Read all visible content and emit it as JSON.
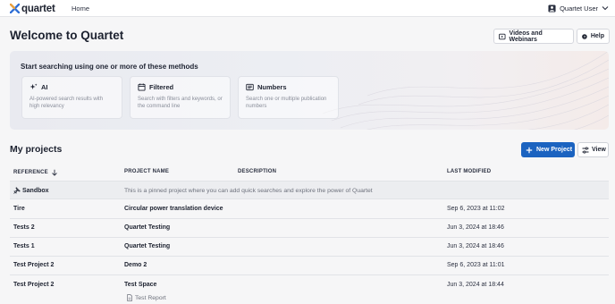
{
  "app": {
    "brand": "quartet",
    "nav_home": "Home",
    "user_name": "Quartet User",
    "colors": {
      "accent": "#1b63c0",
      "logo_mark": "#2f6fd6",
      "text": "#1d2230",
      "muted": "#6d717c"
    }
  },
  "header": {
    "title": "Welcome to Quartet",
    "videos_label": "Videos and Webinars",
    "help_label": "Help"
  },
  "search": {
    "title": "Start searching using one or more of these methods",
    "methods": [
      {
        "label": "AI",
        "icon": "sparkle-icon",
        "description": "AI-powered search results with high relevancy"
      },
      {
        "label": "Filtered",
        "icon": "calendar-icon",
        "description": "Search with filters and keywords, or the command line"
      },
      {
        "label": "Numbers",
        "icon": "numbers-icon",
        "description": "Search one or multiple publication numbers"
      }
    ]
  },
  "projects": {
    "title": "My projects",
    "new_label": "New Project",
    "view_label": "View",
    "columns": {
      "reference": "REFERENCE",
      "name": "PROJECT NAME",
      "description": "DESCRIPTION",
      "modified": "LAST MODIFIED"
    },
    "sandbox": {
      "name": "Sandbox",
      "description": "This is a pinned project where you can add quick searches and explore the power of Quartet"
    },
    "rows": [
      {
        "reference": "Tire",
        "name": "Circular power translation device",
        "modified": "Sep 6, 2023 at 11:02"
      },
      {
        "reference": "Tests 2",
        "name": "Quartet Testing",
        "modified": "Jun 3, 2024 at 18:46"
      },
      {
        "reference": "Tests 1",
        "name": "Quartet Testing",
        "modified": "Jun 3, 2024 at 18:46"
      },
      {
        "reference": "Test Project 2",
        "name": "Demo 2",
        "modified": "Sep 6, 2023 at 11:01"
      },
      {
        "reference": "Test Project 2",
        "name": "Test Space",
        "modified": "Jun 3, 2024 at 18:44",
        "sub_item": "Test Report"
      }
    ]
  }
}
